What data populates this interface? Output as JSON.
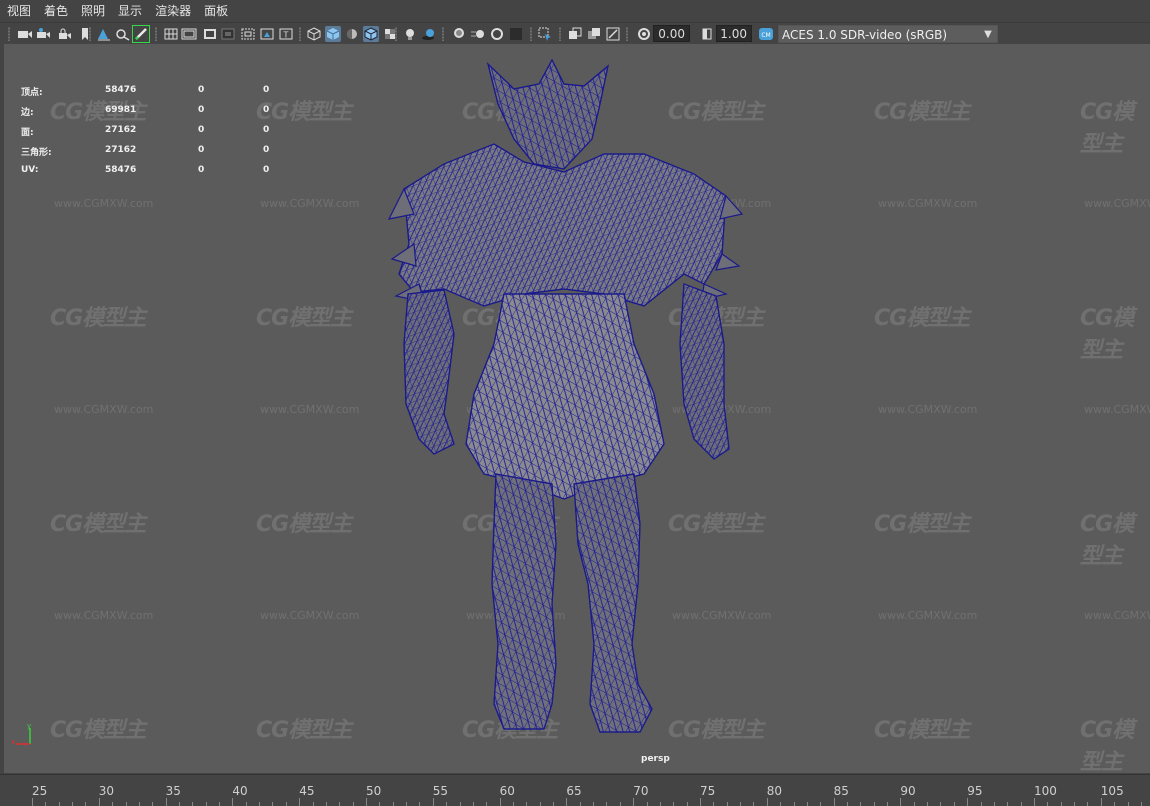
{
  "menu": [
    "视图",
    "着色",
    "照明",
    "显示",
    "渲染器",
    "面板"
  ],
  "toolbar": {
    "exposure_value": "0.00",
    "gamma_value": "1.00",
    "color_space": "ACES 1.0 SDR-video (sRGB)",
    "icons": [
      "camera-icon",
      "camera-attributes-icon",
      "bookmark-icon",
      "image-plane-icon",
      "grease-pencil-icon",
      "grid-icon",
      "film-gate-icon",
      "resolution-gate-icon",
      "gate-mask-icon",
      "field-chart-icon",
      "safe-action-icon",
      "safe-title-icon",
      "wireframe-icon",
      "smooth-shade-icon",
      "shade-wire-icon",
      "wireframe-on-shaded-icon",
      "xray-icon",
      "default-lighting-icon",
      "shadows-icon",
      "ambient-occlusion-icon",
      "motion-blur-icon",
      "antialias-icon",
      "depth-of-field-icon",
      "isolate-select-icon",
      "xray-joints-icon",
      "xray-active-icon",
      "backface-culling-icon",
      "exposure-icon",
      "gamma-icon",
      "color-management-icon"
    ]
  },
  "hud": {
    "rows": [
      {
        "label": "顶点:",
        "c1": "58476",
        "c2": "0",
        "c3": "0"
      },
      {
        "label": "边:",
        "c1": "69981",
        "c2": "0",
        "c3": "0"
      },
      {
        "label": "面:",
        "c1": "27162",
        "c2": "0",
        "c3": "0"
      },
      {
        "label": "三角形:",
        "c1": "27162",
        "c2": "0",
        "c3": "0"
      },
      {
        "label": "UV:",
        "c1": "58476",
        "c2": "0",
        "c3": "0"
      }
    ]
  },
  "viewport": {
    "camera": "persp",
    "watermark_logo": "CG模型主",
    "watermark_url": "www.CGMXW.com",
    "mesh_color": "#1a1a8c",
    "background": "#5b5b5b"
  },
  "timeline": {
    "labels": [
      "25",
      "30",
      "35",
      "40",
      "45",
      "50",
      "55",
      "60",
      "65",
      "70",
      "75",
      "80",
      "85",
      "90",
      "95",
      "100",
      "105"
    ]
  }
}
